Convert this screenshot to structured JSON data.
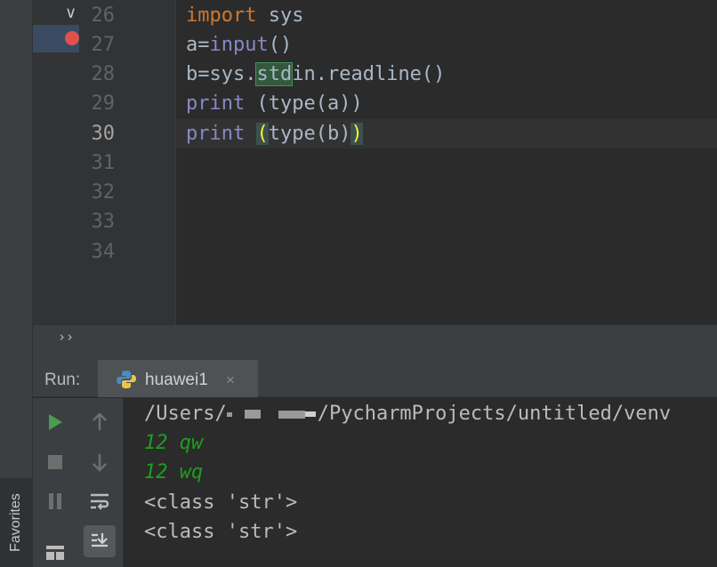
{
  "editor": {
    "line_numbers": [
      "26",
      "27",
      "28",
      "29",
      "30",
      "31",
      "32",
      "33",
      "34"
    ],
    "current_line": "30",
    "lines": [
      {
        "num": "26",
        "kw": "import",
        "rest": " sys"
      },
      {
        "num": "27",
        "var": "a",
        "eq": "=",
        "fn": "input",
        "rest": "()"
      },
      {
        "num": "28",
        "var": "b",
        "eq": "=",
        "pre": "sys.",
        "hl": "std",
        "post": "in.readline()"
      },
      {
        "num": "29",
        "fn": "print",
        "rest": " (type(a))"
      },
      {
        "num": "30",
        "fn": "print",
        "sp": " ",
        "bo": "(",
        "mid": "type(b)",
        "bc": ")"
      }
    ]
  },
  "toolbar": {
    "chevrons": "››"
  },
  "run_panel": {
    "label": "Run:",
    "tab": {
      "label": "huawei1",
      "close": "×"
    }
  },
  "console": {
    "path_start": "/Users/",
    "path_end": "/PycharmProjects/untitled/venv",
    "input_lines": [
      "12 qw",
      "12 wq"
    ],
    "output_lines": [
      "<class 'str'>",
      "<class 'str'>"
    ]
  },
  "sidebar": {
    "favorites_label": "Favorites"
  },
  "colors": {
    "keyword": "#cc7832",
    "builtin": "#8888c6",
    "input_text": "#1c9e1c",
    "breakpoint": "#e0524c",
    "bracket_match": "#ffef28"
  },
  "icons": [
    "fold-chevron-icon",
    "breakpoint-icon",
    "python-icon",
    "run-icon",
    "stop-icon",
    "pause-icon",
    "layout-icon",
    "up-arrow-icon",
    "down-arrow-icon",
    "soft-wrap-icon",
    "scroll-to-end-icon"
  ]
}
